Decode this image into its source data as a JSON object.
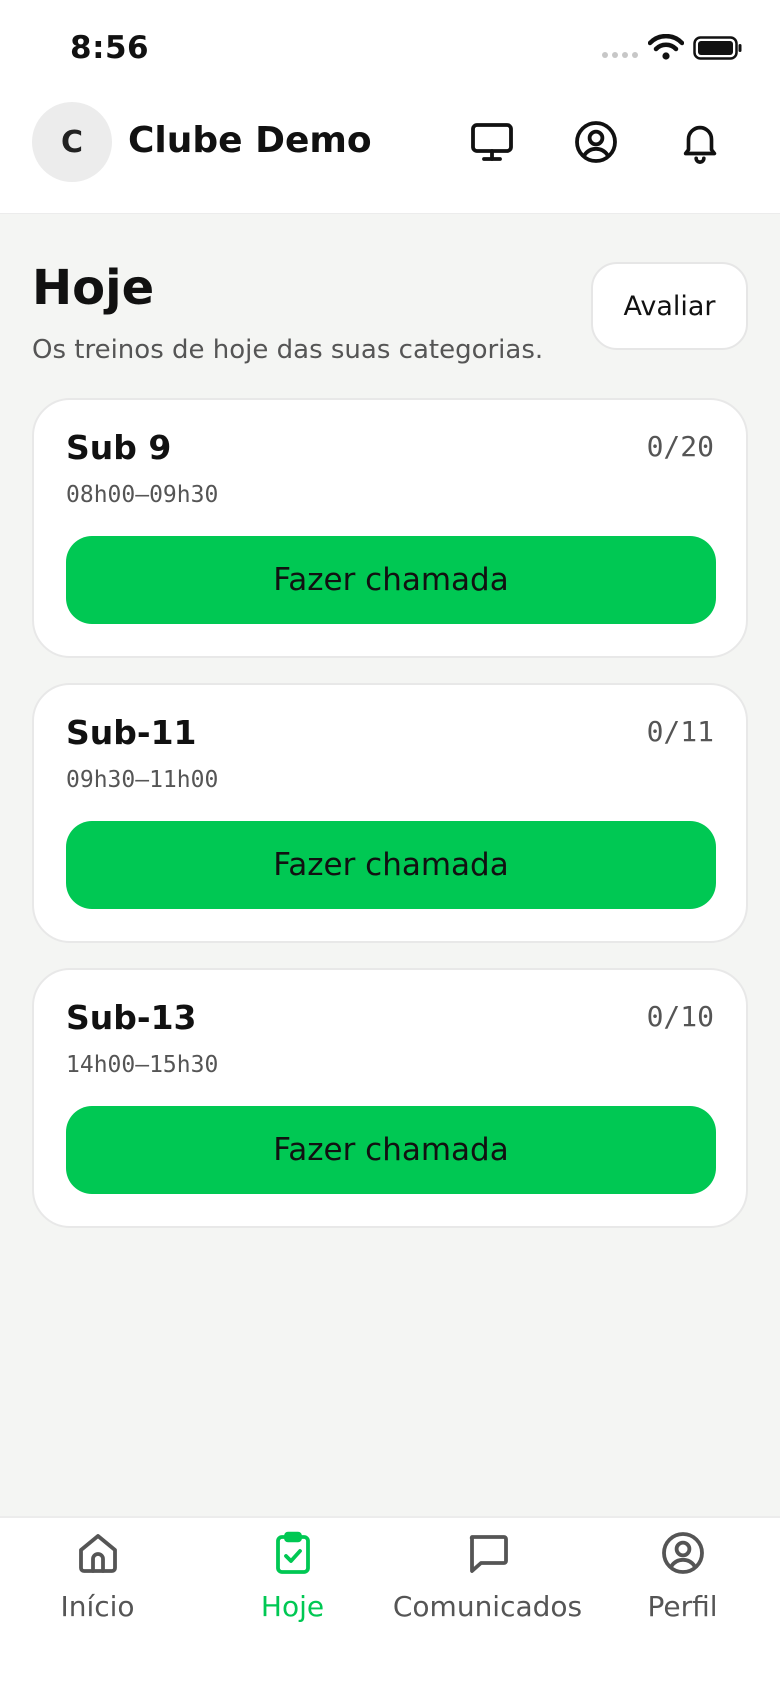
{
  "status_bar": {
    "time": "8:56"
  },
  "header": {
    "avatar_letter": "C",
    "club_name": "Clube Demo",
    "icons": [
      "monitor-icon",
      "user-circle-icon",
      "bell-icon"
    ]
  },
  "main": {
    "title": "Hoje",
    "subtitle": "Os treinos de hoje das suas categorias.",
    "evaluate_label": "Avaliar",
    "sessions": [
      {
        "name": "Sub 9",
        "count": "0/20",
        "time": "08h00–09h30",
        "button_label": "Fazer chamada"
      },
      {
        "name": "Sub-11",
        "count": "0/11",
        "time": "09h30–11h00",
        "button_label": "Fazer chamada"
      },
      {
        "name": "Sub-13",
        "count": "0/10",
        "time": "14h00–15h30",
        "button_label": "Fazer chamada"
      }
    ]
  },
  "bottom_nav": {
    "items": [
      {
        "label": "Início",
        "icon": "home-icon",
        "active": false
      },
      {
        "label": "Hoje",
        "icon": "clipboard-check-icon",
        "active": true
      },
      {
        "label": "Comunicados",
        "icon": "message-square-icon",
        "active": false
      },
      {
        "label": "Perfil",
        "icon": "user-circle-icon",
        "active": false
      }
    ]
  },
  "colors": {
    "accent": "#00c853",
    "background": "#f4f5f3",
    "surface": "#ffffff",
    "text": "#111111",
    "muted": "#555555"
  }
}
